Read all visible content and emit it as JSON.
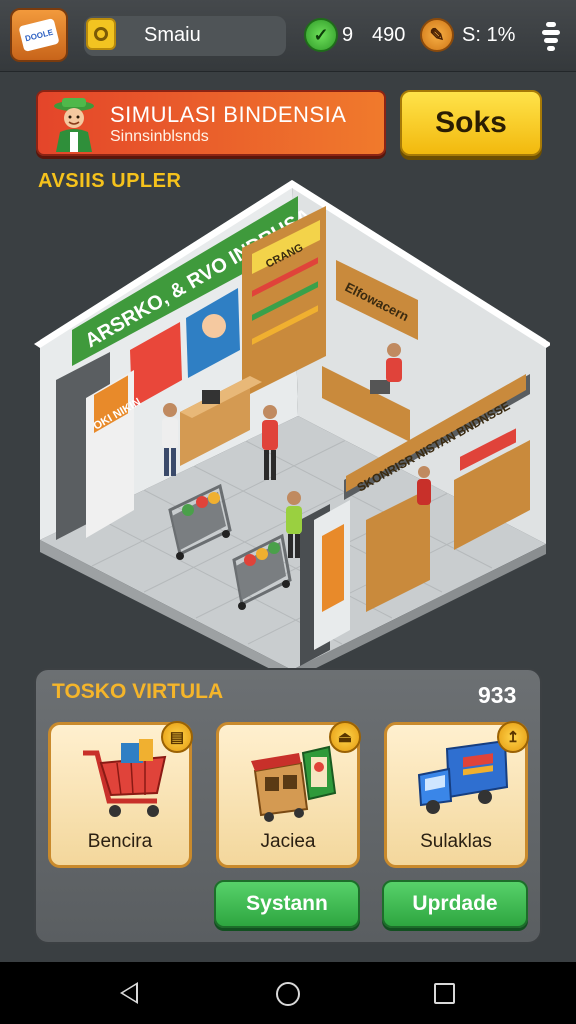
{
  "topbar": {
    "app_icon_text": "DOOLE",
    "player_name": "Smaiu",
    "green_stat": "9",
    "coins": "490",
    "orange_stat": "S: 1%"
  },
  "banner": {
    "title": "SIMULASI BINDENSIA",
    "subtitle": "Sinnsinblsnds",
    "action_label": "Soks"
  },
  "section_label": "AVSIIS UPLER",
  "store_signs": {
    "main_sign": "ARSRKO, & RVO INDRUSA",
    "shelf_sign": "CRANG",
    "back_sign": "Elfowacern",
    "counter_sign": "SKONRISR NISTAN BNDNSSE",
    "poster_text": "OKI NIKIN"
  },
  "panel": {
    "title": "TOSKO VIRTULA",
    "count": "933",
    "cards": [
      {
        "label": "Bencira",
        "badge": "▤"
      },
      {
        "label": "Jaciea",
        "badge": "⏏"
      },
      {
        "label": "Sulaklas",
        "badge": "↥"
      }
    ],
    "buttons": [
      {
        "label": "Systann"
      },
      {
        "label": "Uprdade"
      }
    ]
  },
  "colors": {
    "accent_yellow": "#f5c21c",
    "banner_red": "#e4452a",
    "button_green": "#2ea640",
    "panel_bg": "#6c7073"
  }
}
